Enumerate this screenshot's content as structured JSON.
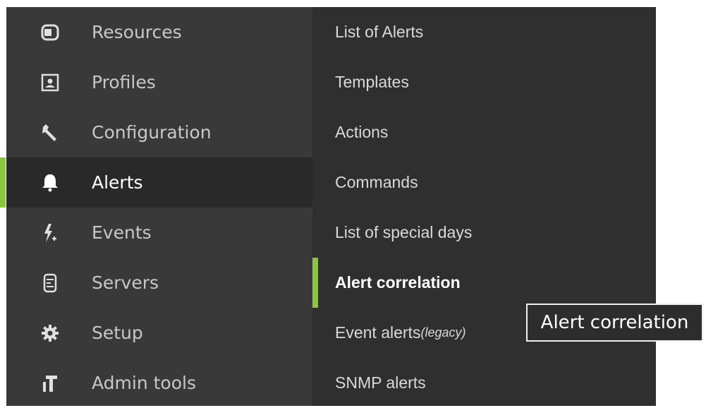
{
  "sidebar": {
    "items": [
      {
        "label": "Resources",
        "icon": "resources-icon"
      },
      {
        "label": "Profiles",
        "icon": "profiles-icon"
      },
      {
        "label": "Configuration",
        "icon": "wrench-icon"
      },
      {
        "label": "Alerts",
        "icon": "bell-icon",
        "active": true
      },
      {
        "label": "Events",
        "icon": "lightning-icon"
      },
      {
        "label": "Servers",
        "icon": "server-icon"
      },
      {
        "label": "Setup",
        "icon": "gear-icon"
      },
      {
        "label": "Admin tools",
        "icon": "admin-tools-icon"
      }
    ]
  },
  "submenu": {
    "items": [
      {
        "label": "List of Alerts"
      },
      {
        "label": "Templates"
      },
      {
        "label": "Actions"
      },
      {
        "label": "Commands"
      },
      {
        "label": "List of special days"
      },
      {
        "label": "Alert correlation",
        "active": true
      },
      {
        "label": "Event alerts",
        "suffix": "(legacy)"
      },
      {
        "label": "SNMP alerts"
      }
    ]
  },
  "tooltip": {
    "text": "Alert correlation"
  },
  "colors": {
    "accent": "#8cc640",
    "sidebar_bg": "#393939",
    "sidebar_active_bg": "#292929",
    "submenu_bg": "#2f2f2f"
  }
}
